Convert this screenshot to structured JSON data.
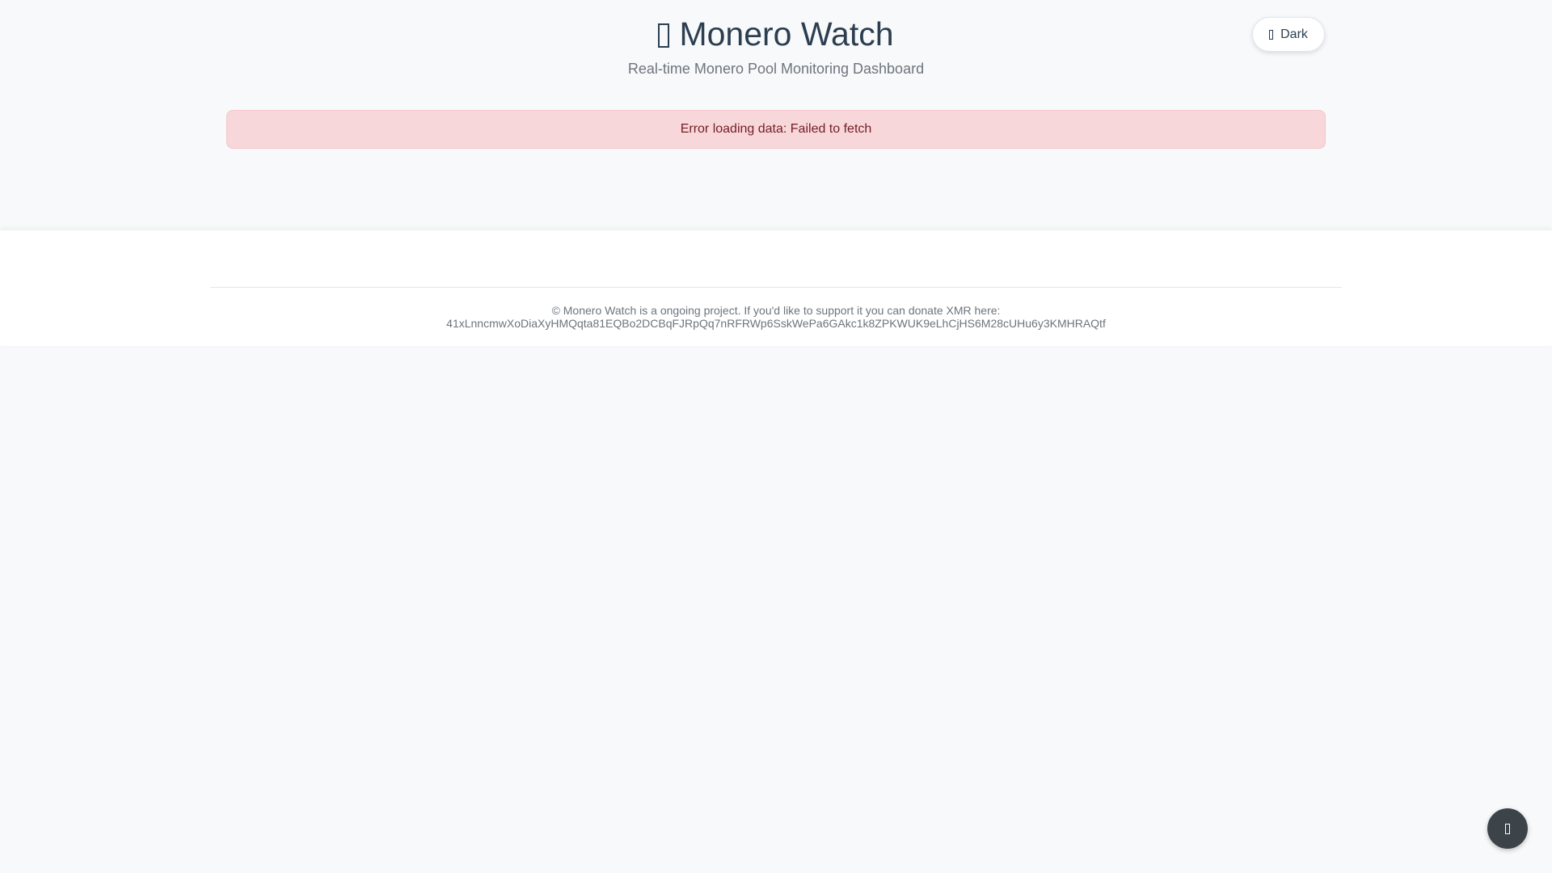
{
  "header": {
    "title": "Monero Watch",
    "title_icon": "missing-glyph-icon",
    "subtitle": "Real-time Monero Pool Monitoring Dashboard",
    "theme_toggle": {
      "label": "Dark",
      "icon": "missing-glyph-icon"
    }
  },
  "error": {
    "message": "Error loading data: Failed to fetch"
  },
  "footer": {
    "line1": "© Monero Watch is a ongoing project. If you'd like to support it you can donate XMR here:",
    "address": "41xLnncmwXoDiaXyHMQqta81EQBo2DCBqFJRpQq7nRFRWp6SskWePa6GAkc1k8ZPKWUK9eLhCjHS6M28cUHu6y3KMHRAQtf"
  },
  "scroll_top": {
    "icon": "missing-glyph-icon"
  },
  "colors": {
    "background": "#f8f9fa",
    "title": "#2c3e50",
    "subtitle": "#6c757d",
    "error_bg": "#f8d7da",
    "error_text": "#721c24",
    "scroll_button": "#3d4449"
  }
}
